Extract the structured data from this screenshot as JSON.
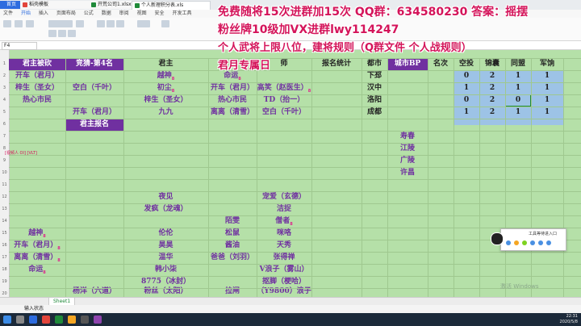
{
  "window": {
    "tabs": [
      {
        "label": "首页"
      },
      {
        "label": "稻壳模板"
      },
      {
        "label": "开荒公司1.xlsx"
      },
      {
        "label": "个人新理积分表.xls"
      }
    ]
  },
  "menu": [
    "文件",
    "开始",
    "插入",
    "页面布局",
    "公式",
    "数据",
    "审阅",
    "视图",
    "安全",
    "开发工具"
  ],
  "menu_active": "开始",
  "formula": {
    "cell_ref": "F4"
  },
  "header_row": {
    "c1": "君主被砍",
    "c2": "竞猜-第4名",
    "c3": "君主",
    "c4": "",
    "c5": "",
    "c6": "师",
    "c7": "报名统计",
    "c8": "都市",
    "c9": "城市BP",
    "c10": "名次",
    "c11": "空投",
    "c12": "锦囊",
    "c13": "同盟",
    "c14": "军饷"
  },
  "rows": [
    {
      "a": "开车（君月）",
      "c": "越神",
      "d": "命运",
      "h": "下邳",
      "k": "0",
      "l": "2",
      "m": "1",
      "n": "1"
    },
    {
      "a": "梓生（圣女）",
      "b": "空白（千叶）",
      "c": "初尘",
      "d": "开车（君月）",
      "e": "高笑（赵医生）",
      "h": "汉中",
      "k": "1",
      "l": "2",
      "m": "1",
      "n": "1"
    },
    {
      "a": "热心市民",
      "c": "梓生（圣女）",
      "d": "热心市民",
      "e": "TD（抬一）",
      "h": "洛阳",
      "k": "0",
      "l": "2",
      "m": "0",
      "n": "1"
    },
    {
      "b": "开车（君月）",
      "c": "九九",
      "d": "离离（清雪）",
      "e": "空白（千叶）",
      "h": "成都",
      "k": "1",
      "l": "2",
      "m": "1",
      "n": "1"
    }
  ],
  "junzhu_baoming": "君主报名",
  "cities_extra": [
    "寿春",
    "江陵",
    "广陵",
    "许昌"
  ],
  "lower_rows": [
    {
      "c": "夜见",
      "e": "宠爱（玄德）"
    },
    {
      "c": "发疯（龙魂）",
      "e": "洁捉"
    },
    {
      "d": "陌雯",
      "e": "僧者"
    },
    {
      "a": "越神",
      "c": "伦伦",
      "d": "松鼠",
      "e": "咪咯"
    },
    {
      "a": "开车（君月）",
      "c": "昊昊",
      "d": "酱油",
      "e": "天秀"
    },
    {
      "a": "离离（清雪）",
      "c": "温华",
      "d": "爸爸（刘羽）",
      "e": "张得禅"
    },
    {
      "a": "命运",
      "c": "韩小柒",
      "e": "V浪子（雾山）"
    },
    {
      "c": "8775（冰封）",
      "e": "抠脚（梗哈）"
    },
    {
      "b": "杨洋（六道）",
      "c": "粉丝（太阳）",
      "d": "拉闸",
      "e": "（Y9800）浪子"
    }
  ],
  "annotations": {
    "mark": "8",
    "sidebar_label": "[视频人 OI] [VLT]"
  },
  "overlay": {
    "line1": "免费随将15次进群加15次 QQ群：634580230 答案：摇摆",
    "line2": "粉丝牌10级加VX进群lwy114247",
    "line3": "个人武将上限八位，建将规则（Q群文件 个人战规则）",
    "line4": "君月专属日"
  },
  "sheet": {
    "tab": "Sheet1",
    "status": "输入状态"
  },
  "chat": {
    "title": "工具等待进入口"
  },
  "watermark": "激活 Windows",
  "clock": {
    "time": "22:31",
    "date": "2020/5/8"
  },
  "colors": {
    "grid_bg": "#b5e0a8",
    "header": "#7030a0",
    "blue_block": "#9dc3e6",
    "overlay_text": "#d4145a"
  }
}
